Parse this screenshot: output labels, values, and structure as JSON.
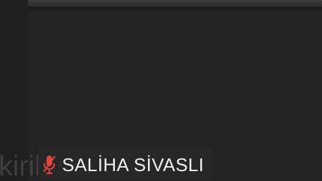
{
  "participant": {
    "name": "SALİHA SİVASLI",
    "mic_status": "muted",
    "mic_icon": "microphone-muted-icon"
  },
  "background_caption": "kirilesti",
  "colors": {
    "tile_background": "#242424",
    "muted_icon": "#e0443c",
    "name_text": "#f2f2f2"
  }
}
